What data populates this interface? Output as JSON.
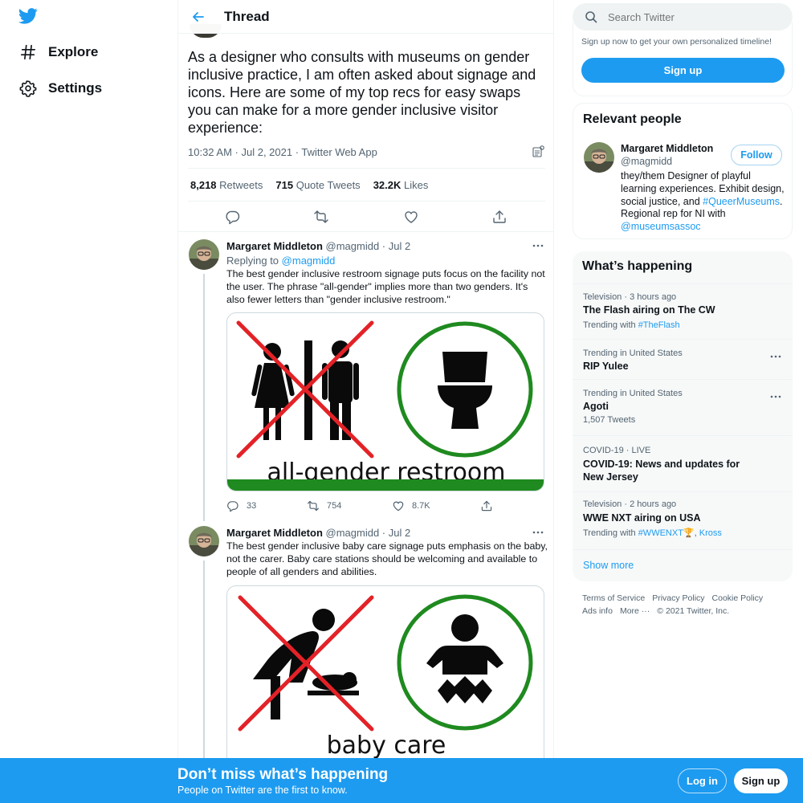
{
  "colors": {
    "accent": "#1d9bf0",
    "text": "#0f1419",
    "muted": "#536471",
    "sign_red": "#e32227",
    "sign_green": "#1f8a1f"
  },
  "nav": {
    "logo_icon": "twitter-bird-icon",
    "items": [
      {
        "icon": "hashtag-icon",
        "label": "Explore"
      },
      {
        "icon": "gear-icon",
        "label": "Settings"
      }
    ]
  },
  "header": {
    "back_icon": "arrow-left-icon",
    "title": "Thread"
  },
  "main_tweet": {
    "text": "As a designer who consults with museums on gender inclusive practice, I am often asked about signage and icons. Here are some of my top recs for easy swaps you can make for a more gender inclusive visitor experience:",
    "meta": "10:32 AM · Jul 2, 2021 · Twitter Web App",
    "stats": [
      {
        "value": "8,218",
        "label": "Retweets"
      },
      {
        "value": "715",
        "label": "Quote Tweets"
      },
      {
        "value": "32.2K",
        "label": "Likes"
      }
    ],
    "actions": [
      "reply-icon",
      "retweet-icon",
      "like-icon",
      "share-icon"
    ]
  },
  "replies": [
    {
      "name": "Margaret Middleton",
      "handle": "@magmidd · Jul 2",
      "replying_prefix": "Replying to",
      "replying_handle": "@magmidd",
      "text": "The best gender inclusive restroom signage puts focus on the facility not the user. The phrase \"all-gender\" implies more than two genders. It's also fewer letters than \"gender inclusive restroom.\"",
      "media_caption": "all-gender restroom",
      "counts": {
        "replies": "33",
        "retweets": "754",
        "likes": "8.7K"
      }
    },
    {
      "name": "Margaret Middleton",
      "handle": "@magmidd · Jul 2",
      "text": "The best gender inclusive baby care signage puts emphasis on the baby, not the carer. Baby care stations should be welcoming and available to people of all genders and abilities.",
      "media_caption": "baby care"
    }
  ],
  "search": {
    "placeholder": "Search Twitter"
  },
  "signup_card": {
    "text": "Sign up now to get your own personalized timeline!",
    "button": "Sign up"
  },
  "relevant_people": {
    "title": "Relevant people",
    "name": "Margaret Middleton",
    "handle": "@magmidd",
    "follow": "Follow",
    "bio_1": "they/them Designer of playful learning experiences. Exhibit design, social justice, and ",
    "bio_tag": "#QueerMuseums",
    "bio_2": ". Regional rep for NI with ",
    "bio_mention": "@museumsassoc"
  },
  "trends": {
    "title": "What’s happening",
    "items": [
      {
        "meta": "Television · 3 hours ago",
        "title": "The Flash airing on The CW",
        "sub_prefix": "Trending with",
        "sub_link": "#TheFlash"
      },
      {
        "meta": "Trending in United States",
        "title": "RIP Yulee"
      },
      {
        "meta": "Trending in United States",
        "title": "Agoti",
        "sub": "1,507 Tweets"
      },
      {
        "meta": "COVID-19 · LIVE",
        "title": "COVID-19: News and updates for New Jersey"
      },
      {
        "meta": "Television · 2 hours ago",
        "title": "WWE NXT airing on USA",
        "sub_prefix": "Trending with",
        "sub_link": "#WWENXT",
        "sub_link2": "Kross"
      }
    ],
    "show_more": "Show more"
  },
  "footer": {
    "links": [
      "Terms of Service",
      "Privacy Policy",
      "Cookie Policy",
      "Ads info",
      "More ···"
    ],
    "copyright": "© 2021 Twitter, Inc."
  },
  "bottom_bar": {
    "title": "Don’t miss what’s happening",
    "subtitle": "People on Twitter are the first to know.",
    "login": "Log in",
    "signup": "Sign up"
  }
}
